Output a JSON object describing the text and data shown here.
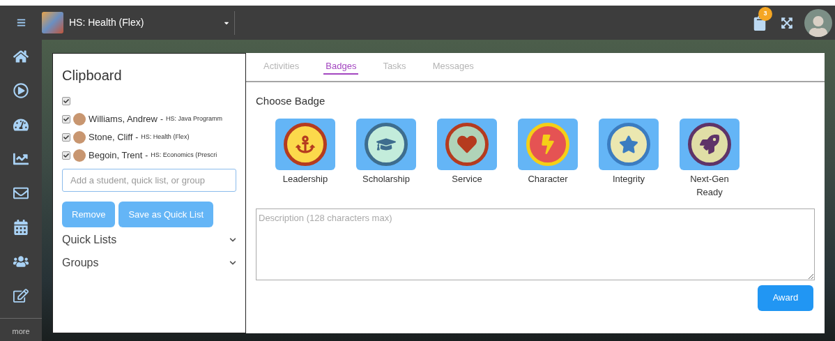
{
  "topbar": {
    "course": "HS: Health (Flex)",
    "notification_count": "3"
  },
  "sidebar": {
    "items": [
      {
        "kind": "home"
      },
      {
        "kind": "play"
      },
      {
        "kind": "gauge"
      },
      {
        "kind": "chart"
      },
      {
        "kind": "mail"
      },
      {
        "kind": "calendar"
      },
      {
        "kind": "people"
      },
      {
        "kind": "edit"
      }
    ],
    "more": "more"
  },
  "clipboard": {
    "title": "Clipboard",
    "select_all": {
      "checked": true
    },
    "students": [
      {
        "name": "Williams, Andrew",
        "separator": "-",
        "course": "HS: Java Programm",
        "checked": true
      },
      {
        "name": "Stone, Cliff",
        "separator": "-",
        "course": "HS: Health (Flex)",
        "checked": true
      },
      {
        "name": "Begoin, Trent",
        "separator": "-",
        "course": "HS: Economics (Prescri",
        "checked": true
      }
    ],
    "search": {
      "placeholder": "Add a student, quick list, or group"
    },
    "buttons": [
      "Remove",
      "Save as Quick List"
    ],
    "sections": [
      {
        "label": "Quick Lists",
        "expanded": false
      },
      {
        "label": "Groups",
        "expanded": false
      }
    ]
  },
  "tabs": [
    {
      "label": "Activities",
      "selected": false
    },
    {
      "label": "Badges",
      "selected": true
    },
    {
      "label": "Tasks",
      "selected": false
    },
    {
      "label": "Messages",
      "selected": false
    }
  ],
  "badge_panel": {
    "title": "Choose Badge",
    "badges": [
      {
        "label": "Leadership",
        "kind": "anchor"
      },
      {
        "label": "Scholarship",
        "kind": "cap"
      },
      {
        "label": "Service",
        "kind": "heart"
      },
      {
        "label": "Character",
        "kind": "bolt"
      },
      {
        "label": "Integrity",
        "kind": "star"
      },
      {
        "label": "Next-Gen Ready",
        "kind": "rocket"
      }
    ],
    "description": {
      "placeholder": "Description (128 characters max)"
    },
    "award_button": "Award"
  }
}
